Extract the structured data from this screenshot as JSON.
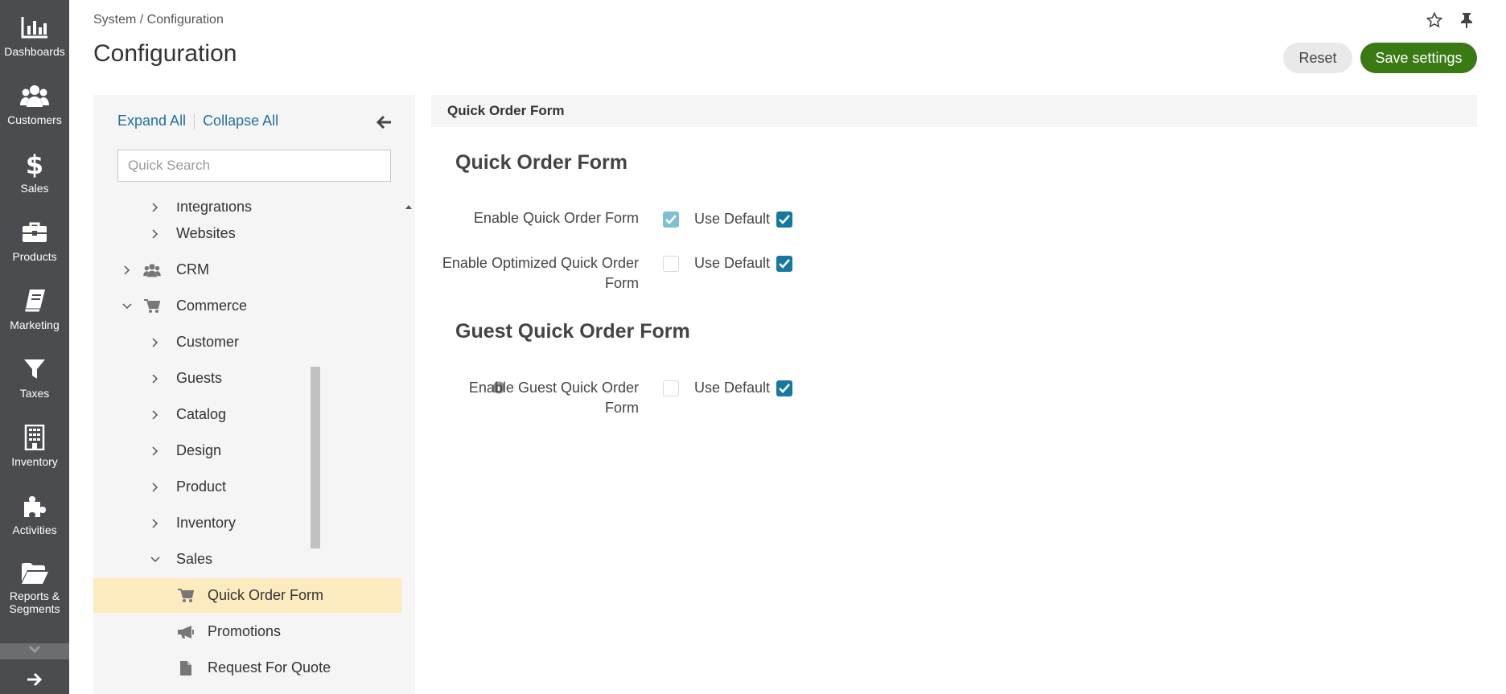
{
  "nav": {
    "items": [
      {
        "label": "Dashboards",
        "icon": "bar-chart-icon"
      },
      {
        "label": "Customers",
        "icon": "users-icon"
      },
      {
        "label": "Sales",
        "icon": "dollar-icon"
      },
      {
        "label": "Products",
        "icon": "briefcase-icon"
      },
      {
        "label": "Marketing",
        "icon": "book-icon"
      },
      {
        "label": "Taxes",
        "icon": "filter-icon"
      },
      {
        "label": "Inventory",
        "icon": "building-icon"
      },
      {
        "label": "Activities",
        "icon": "puzzle-icon"
      },
      {
        "label": "Reports &\nSegments",
        "icon": "folder-icon"
      }
    ]
  },
  "header": {
    "breadcrumb": "System / Configuration",
    "title": "Configuration",
    "reset_label": "Reset",
    "save_label": "Save settings"
  },
  "sidebar": {
    "expand_all": "Expand All",
    "collapse_all": "Collapse All",
    "search_placeholder": "Quick Search",
    "tree": [
      {
        "label": "Integrations",
        "level": 1,
        "expanded": false
      },
      {
        "label": "Websites",
        "level": 1,
        "expanded": false
      },
      {
        "label": "CRM",
        "level": 0,
        "expanded": false,
        "icon": "users-icon"
      },
      {
        "label": "Commerce",
        "level": 0,
        "expanded": true,
        "icon": "cart-icon"
      },
      {
        "label": "Customer",
        "level": 1,
        "expanded": false
      },
      {
        "label": "Guests",
        "level": 1,
        "expanded": false
      },
      {
        "label": "Catalog",
        "level": 1,
        "expanded": false
      },
      {
        "label": "Design",
        "level": 1,
        "expanded": false
      },
      {
        "label": "Product",
        "level": 1,
        "expanded": false
      },
      {
        "label": "Inventory",
        "level": 1,
        "expanded": false
      },
      {
        "label": "Sales",
        "level": 1,
        "expanded": true
      },
      {
        "label": "Quick Order Form",
        "level": 2,
        "selected": true,
        "icon": "cart-icon"
      },
      {
        "label": "Promotions",
        "level": 2,
        "icon": "megaphone-icon"
      },
      {
        "label": "Request For Quote",
        "level": 2,
        "icon": "file-icon"
      }
    ]
  },
  "content": {
    "section_title": "Quick Order Form",
    "group1_title": "Quick Order Form",
    "group2_title": "Guest Quick Order Form",
    "use_default": "Use Default",
    "fields": [
      {
        "label": "Enable Quick Order Form",
        "value": true,
        "use_default": true
      },
      {
        "label": "Enable Optimized Quick Order Form",
        "value": false,
        "use_default": true
      },
      {
        "label": "Enable Guest Quick Order Form",
        "value": false,
        "use_default": true
      }
    ]
  },
  "colors": {
    "nav_bg": "#4a4c4f",
    "save_button": "#3a7a14",
    "link": "#236fa1",
    "checkbox": "#16789f",
    "selected_row": "#fdebc0"
  }
}
